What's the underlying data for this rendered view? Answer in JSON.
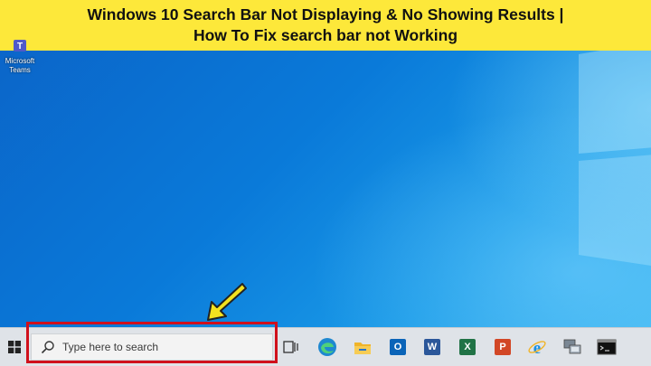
{
  "banner": {
    "line1": "Windows 10 Search Bar Not Displaying & No Showing Results |",
    "line2": "How To Fix search bar not Working"
  },
  "desktop": {
    "icons": [
      {
        "label_line1": "Microsoft",
        "label_line2": "Teams",
        "icon": "teams-icon"
      }
    ]
  },
  "taskbar": {
    "search_placeholder": "Type here to search",
    "pinned": [
      {
        "name": "task-view-icon"
      },
      {
        "name": "edge-icon"
      },
      {
        "name": "file-explorer-icon"
      },
      {
        "name": "outlook-icon",
        "letter": "O",
        "color": "#0a64b8"
      },
      {
        "name": "word-icon",
        "letter": "W",
        "color": "#2b579a"
      },
      {
        "name": "excel-icon",
        "letter": "X",
        "color": "#217346"
      },
      {
        "name": "powerpoint-icon",
        "letter": "P",
        "color": "#d24726"
      },
      {
        "name": "internet-explorer-icon"
      },
      {
        "name": "network-icon"
      },
      {
        "name": "command-prompt-icon"
      }
    ]
  },
  "colors": {
    "banner_bg": "#fde83a",
    "highlight": "#d0101c",
    "arrow": "#f3e21f"
  }
}
